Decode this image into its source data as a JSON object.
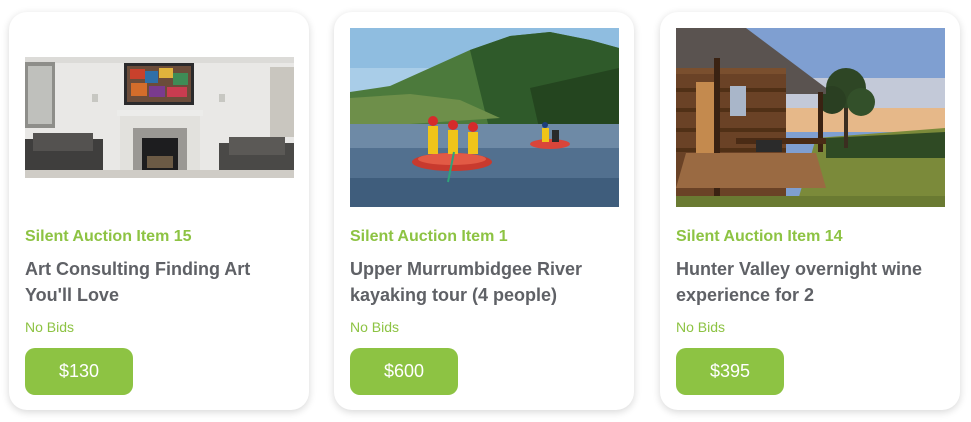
{
  "colors": {
    "accent": "#8dc343",
    "title": "#5f6166",
    "button_text": "#ffffff"
  },
  "cards": [
    {
      "subtitle": "Silent Auction Item 15",
      "title": "Art Consulting Finding Art You'll Love",
      "bids": "No Bids",
      "price": "$130",
      "image": "living-room-with-painting"
    },
    {
      "subtitle": "Silent Auction Item 1",
      "title": "Upper Murrumbidgee River kayaking tour (4 people)",
      "bids": "No Bids",
      "price": "$600",
      "image": "river-rafting"
    },
    {
      "subtitle": "Silent Auction Item 14",
      "title": "Hunter Valley overnight wine experience for 2",
      "bids": "No Bids",
      "price": "$395",
      "image": "cabin-veranda-at-sunset"
    }
  ]
}
